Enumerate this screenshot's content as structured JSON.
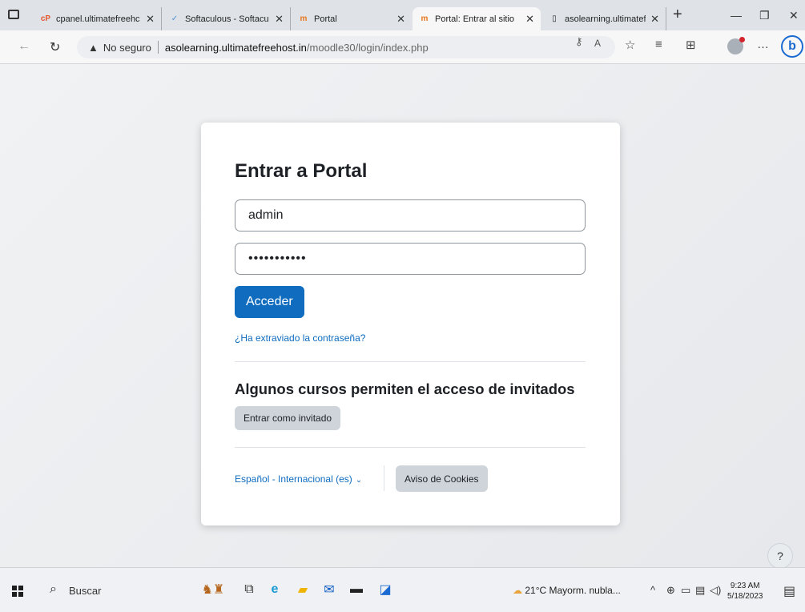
{
  "browser": {
    "tabs": [
      {
        "title": "cpanel.ultimatefreehc",
        "favicon": "cpanel-icon",
        "color": "#e4572e"
      },
      {
        "title": "Softaculous - Softacu",
        "favicon": "softaculous-icon",
        "color": "#4d90d6"
      },
      {
        "title": "Portal",
        "favicon": "moodle-icon",
        "color": "#e8771e"
      },
      {
        "title": "Portal: Entrar al sitio",
        "favicon": "moodle-icon",
        "color": "#e8771e",
        "active": true
      },
      {
        "title": "asolearning.ultimatef",
        "favicon": "page-icon",
        "color": "#555555"
      }
    ],
    "address": {
      "security": "No seguro",
      "host": "asolearning.ultimatefreehost.in",
      "path": "/moodle30/login/index.php"
    }
  },
  "login": {
    "title": "Entrar a Portal",
    "username": "admin",
    "password": "•••••••••••",
    "submit_label": "Acceder",
    "forgot_label": "¿Ha extraviado la contraseña?",
    "guest_heading": "Algunos cursos permiten el acceso de invitados",
    "guest_button": "Entrar como invitado",
    "language": "Español - Internacional (es)",
    "cookies_button": "Aviso de Cookies",
    "help_label": "?"
  },
  "colors": {
    "primary": "#0f6cbf",
    "secondary_button": "#ced4da",
    "page_bg": "#e9ebee"
  },
  "taskbar": {
    "search_label": "Buscar",
    "weather": "21°C  Mayorm. nubla...",
    "time": "9:23 AM",
    "date": "5/18/2023"
  }
}
